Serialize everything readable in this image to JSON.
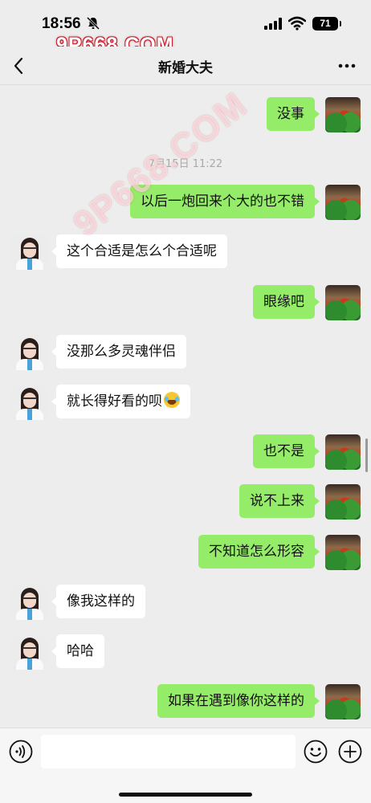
{
  "status_bar": {
    "time": "18:56",
    "battery": "71",
    "icons": [
      "bell-slash-icon",
      "signal-icon",
      "wifi-icon",
      "battery-icon"
    ]
  },
  "watermark": {
    "top": "9P668.COM",
    "diagonal": "9P668.COM"
  },
  "nav": {
    "back_icon": "chevron-left-icon",
    "title": "新婚大夫",
    "more_icon": "more-dots-icon"
  },
  "chat": {
    "messages": [
      {
        "side": "self",
        "text": "没事"
      },
      {
        "side": "timestamp",
        "text": "7月15日 11:22"
      },
      {
        "side": "self",
        "text": "以后一炮回来个大的也不错"
      },
      {
        "side": "other",
        "text": "这个合适是怎么个合适呢"
      },
      {
        "side": "self",
        "text": "眼缘吧"
      },
      {
        "side": "other",
        "text": "没那么多灵魂伴侣"
      },
      {
        "side": "other",
        "text": "就长得好看的呗",
        "emoji": "laughing-tears-emoji"
      },
      {
        "side": "self",
        "text": "也不是"
      },
      {
        "side": "self",
        "text": "说不上来"
      },
      {
        "side": "self",
        "text": "不知道怎么形容"
      },
      {
        "side": "other",
        "text": "像我这样的"
      },
      {
        "side": "other",
        "text": "哈哈"
      },
      {
        "side": "self",
        "text": "如果在遇到像你这样的"
      }
    ]
  },
  "input_bar": {
    "voice_icon": "voice-icon",
    "input_value": "",
    "emoji_icon": "emoji-icon",
    "plus_icon": "plus-icon"
  },
  "colors": {
    "background": "#ededed",
    "self_bubble": "#95ec69",
    "other_bubble": "#ffffff",
    "timestamp": "#a9a9a9"
  }
}
